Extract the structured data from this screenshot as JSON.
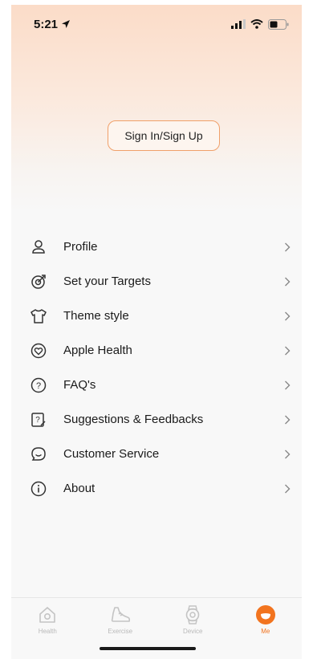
{
  "status_bar": {
    "time": "5:21"
  },
  "signin": {
    "label": "Sign In/Sign Up"
  },
  "menu": {
    "items": [
      {
        "label": "Profile",
        "icon": "person-icon"
      },
      {
        "label": "Set your Targets",
        "icon": "target-icon"
      },
      {
        "label": "Theme style",
        "icon": "tshirt-icon"
      },
      {
        "label": "Apple Health",
        "icon": "heart-icon"
      },
      {
        "label": "FAQ's",
        "icon": "question-icon"
      },
      {
        "label": "Suggestions & Feedbacks",
        "icon": "feedback-icon"
      },
      {
        "label": "Customer Service",
        "icon": "chat-icon"
      },
      {
        "label": "About",
        "icon": "info-icon"
      }
    ]
  },
  "tab_bar": {
    "tabs": [
      {
        "label": "Health",
        "icon": "health-icon"
      },
      {
        "label": "Exercise",
        "icon": "shoe-icon"
      },
      {
        "label": "Device",
        "icon": "watch-icon"
      },
      {
        "label": "Me",
        "icon": "me-icon"
      }
    ],
    "active_index": 3
  },
  "colors": {
    "accent": "#f2741f",
    "header_top": "#fbdcc8",
    "inactive": "#b9b9b9"
  }
}
